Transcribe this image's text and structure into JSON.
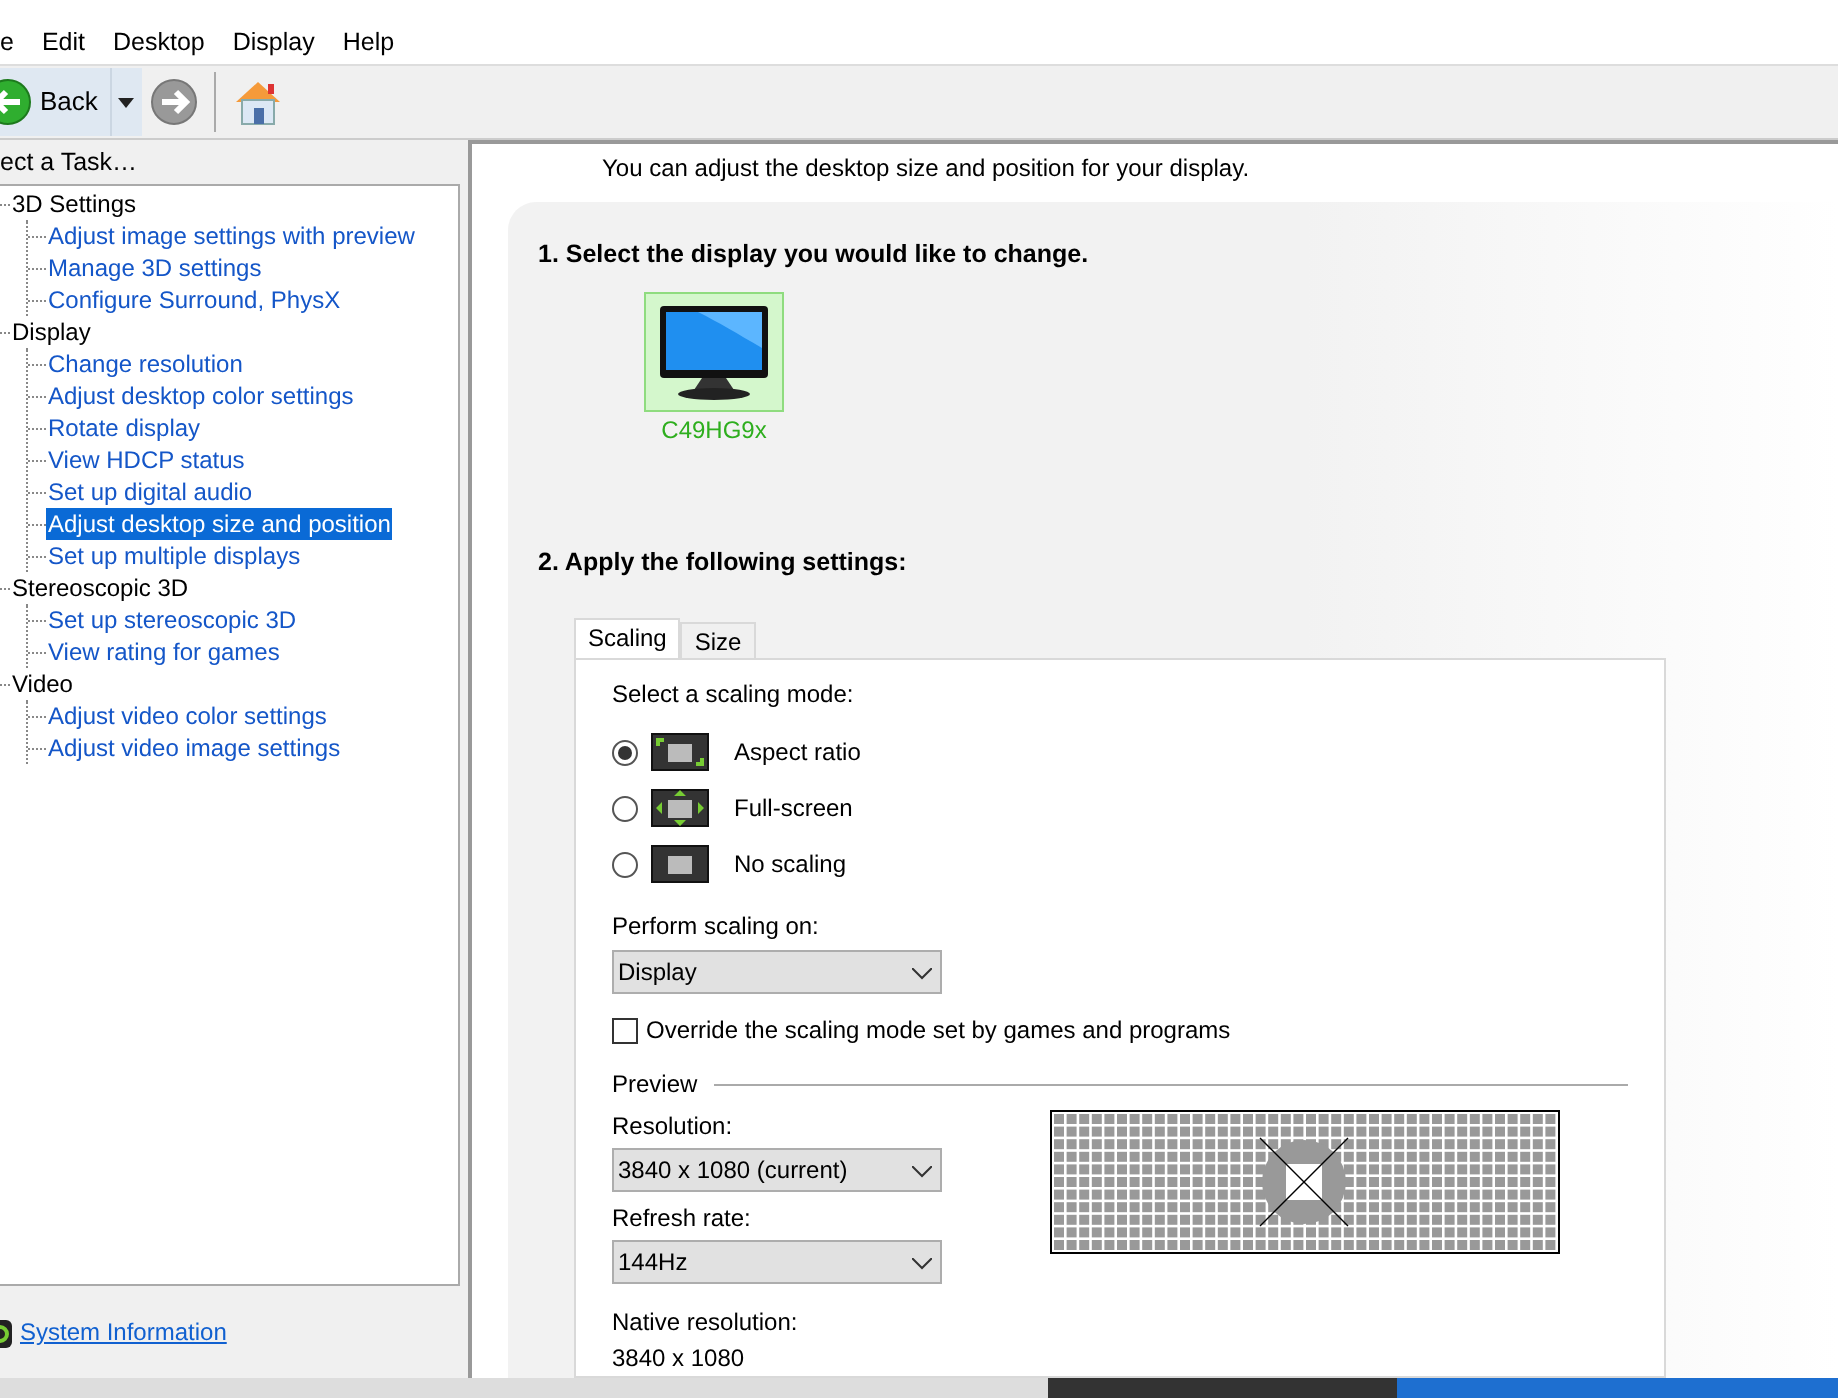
{
  "menu": [
    "e",
    "Edit",
    "Desktop",
    "Display",
    "Help"
  ],
  "toolbar": {
    "back": "Back"
  },
  "task_pane": {
    "title": "ect a Task…",
    "tree": [
      {
        "label": "3D Settings",
        "selected": false,
        "children": [
          {
            "label": "Adjust image settings with preview",
            "selected": false
          },
          {
            "label": "Manage 3D settings",
            "selected": false
          },
          {
            "label": "Configure Surround, PhysX",
            "selected": false
          }
        ]
      },
      {
        "label": "Display",
        "selected": false,
        "children": [
          {
            "label": "Change resolution",
            "selected": false
          },
          {
            "label": "Adjust desktop color settings",
            "selected": false
          },
          {
            "label": "Rotate display",
            "selected": false
          },
          {
            "label": "View HDCP status",
            "selected": false
          },
          {
            "label": "Set up digital audio",
            "selected": false
          },
          {
            "label": "Adjust desktop size and position",
            "selected": true
          },
          {
            "label": "Set up multiple displays",
            "selected": false
          }
        ]
      },
      {
        "label": "Stereoscopic 3D",
        "selected": false,
        "children": [
          {
            "label": "Set up stereoscopic 3D",
            "selected": false
          },
          {
            "label": "View rating for games",
            "selected": false
          }
        ]
      },
      {
        "label": "Video",
        "selected": false,
        "children": [
          {
            "label": "Adjust video color settings",
            "selected": false
          },
          {
            "label": "Adjust video image settings",
            "selected": false
          }
        ]
      }
    ],
    "footer_link": "System Information"
  },
  "content": {
    "intro": "You can adjust the desktop size and position for your display.",
    "step1": "1. Select the display you would like to change.",
    "displays": [
      {
        "name": "C49HG9x",
        "selected": true
      }
    ],
    "step2": "2. Apply the following settings:",
    "tabs": [
      {
        "label": "Scaling",
        "selected": true
      },
      {
        "label": "Size",
        "selected": false
      }
    ],
    "scaling_label": "Select a scaling mode:",
    "modes": [
      {
        "kind": "aspect",
        "label": "Aspect ratio",
        "selected": true
      },
      {
        "kind": "fullscreen",
        "label": "Full-screen",
        "selected": false
      },
      {
        "kind": "none",
        "label": "No scaling",
        "selected": false
      }
    ],
    "perform_label": "Perform scaling on:",
    "perform_value": "Display",
    "override": {
      "label": "Override the scaling mode set by games and programs",
      "checked": false
    },
    "preview_label": "Preview",
    "resolution_label": "Resolution:",
    "resolution_value": "3840 x 1080 (current)",
    "refresh_label": "Refresh rate:",
    "refresh_value": "144Hz",
    "native_label": "Native resolution:",
    "native_value": "3840 x 1080"
  }
}
